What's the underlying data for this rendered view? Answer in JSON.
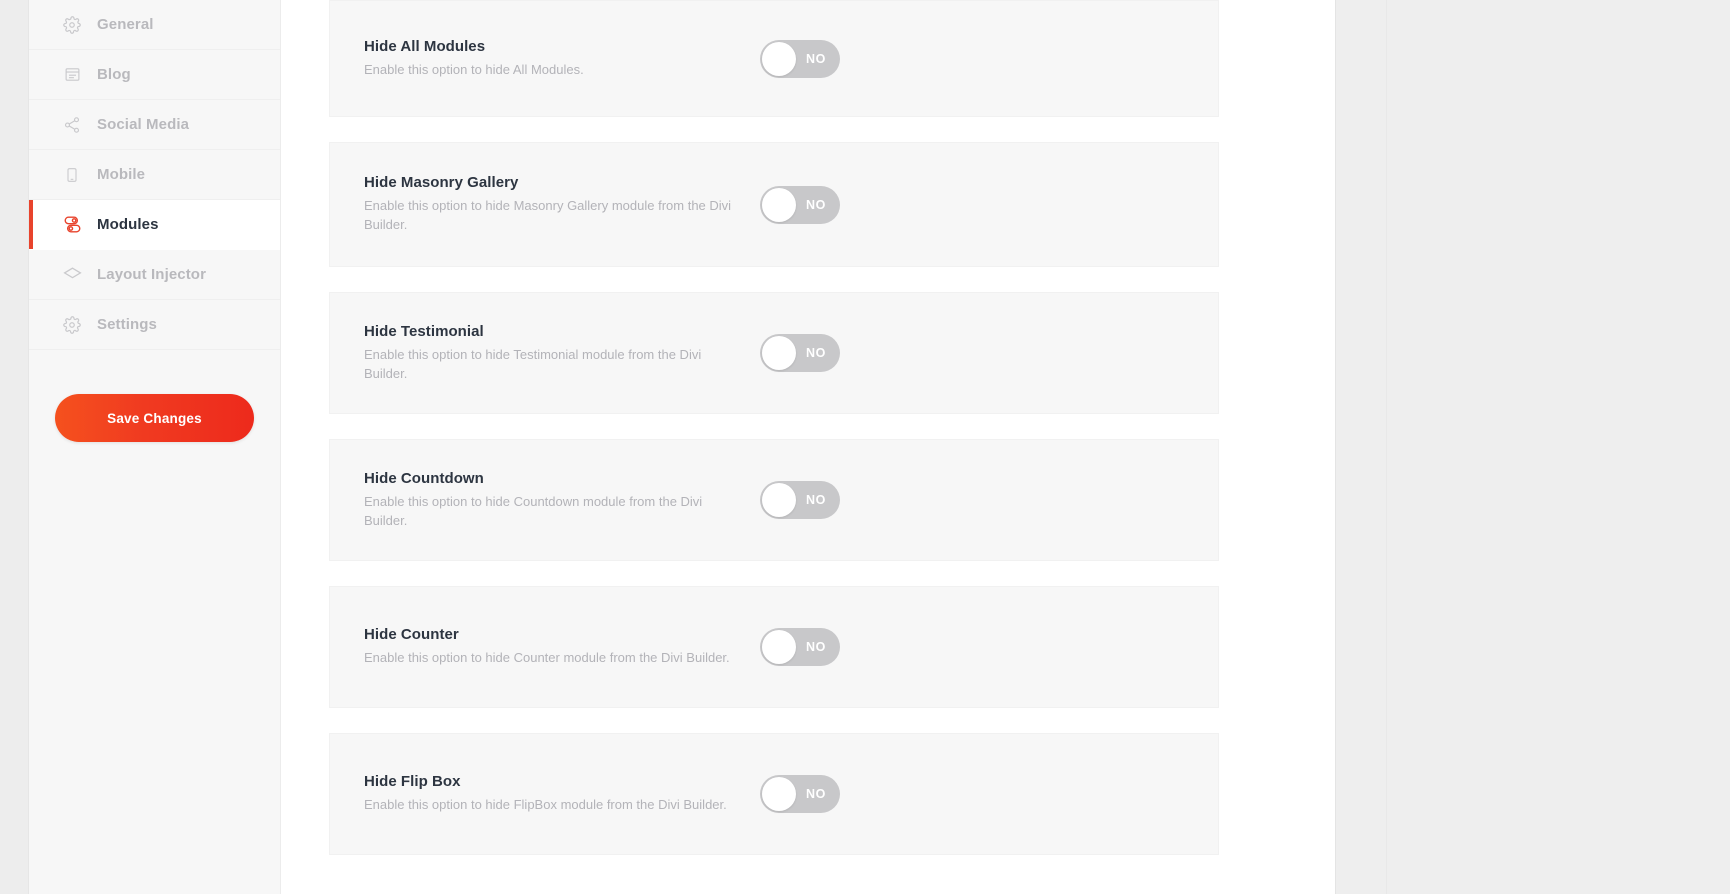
{
  "sidebar": {
    "items": [
      {
        "label": "General",
        "icon": "gear-icon",
        "active": false
      },
      {
        "label": "Blog",
        "icon": "blog-grid-icon",
        "active": false
      },
      {
        "label": "Social Media",
        "icon": "share-nodes-icon",
        "active": false
      },
      {
        "label": "Mobile",
        "icon": "mobile-phone-icon",
        "active": false
      },
      {
        "label": "Modules",
        "icon": "modules-toggles-icon",
        "active": true
      },
      {
        "label": "Layout Injector",
        "icon": "layers-icon",
        "active": false
      },
      {
        "label": "Settings",
        "icon": "gear-icon",
        "active": false
      }
    ],
    "save_label": "Save Changes"
  },
  "colors": {
    "accent": "#e8432c",
    "save_gradient_start": "#f5511e",
    "save_gradient_end": "#ed2a1c",
    "toggle_off_track": "#c8c8ca",
    "toggle_knob": "#ffffff",
    "row_background": "#f7f7f7",
    "title_text": "#2d3541",
    "muted_text": "#b3b3b8"
  },
  "main": {
    "options": [
      {
        "title": "Hide All Modules",
        "description": "Enable this option to hide All Modules.",
        "toggle_label": "NO",
        "toggle_state": "off"
      },
      {
        "title": "Hide Masonry Gallery",
        "description": "Enable this option to hide Masonry Gallery module from the Divi Builder.",
        "toggle_label": "NO",
        "toggle_state": "off"
      },
      {
        "title": "Hide Testimonial",
        "description": "Enable this option to hide Testimonial module from the Divi Builder.",
        "toggle_label": "NO",
        "toggle_state": "off"
      },
      {
        "title": "Hide Countdown",
        "description": "Enable this option to hide Countdown module from the Divi Builder.",
        "toggle_label": "NO",
        "toggle_state": "off"
      },
      {
        "title": "Hide Counter",
        "description": "Enable this option to hide Counter module from the Divi Builder.",
        "toggle_label": "NO",
        "toggle_state": "off"
      },
      {
        "title": "Hide Flip Box",
        "description": "Enable this option to hide FlipBox module from the Divi Builder.",
        "toggle_label": "NO",
        "toggle_state": "off"
      }
    ]
  }
}
